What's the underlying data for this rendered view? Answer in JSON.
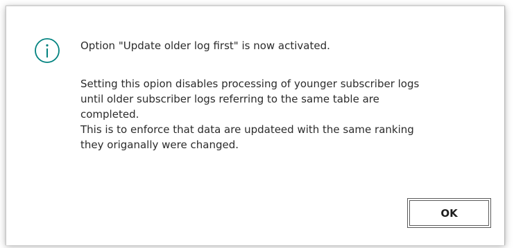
{
  "dialog": {
    "icon": "info-icon",
    "accent_color": "#00827f",
    "title": "Option \"Update older log first\" is now activated.",
    "lines": [
      "Setting this opion disables processing of younger subscriber logs",
      "until older subscriber logs referring to the same table are",
      "completed.",
      "This is to enforce that data are updateed with the same ranking",
      "they origanally were changed."
    ],
    "ok_label": "OK"
  }
}
